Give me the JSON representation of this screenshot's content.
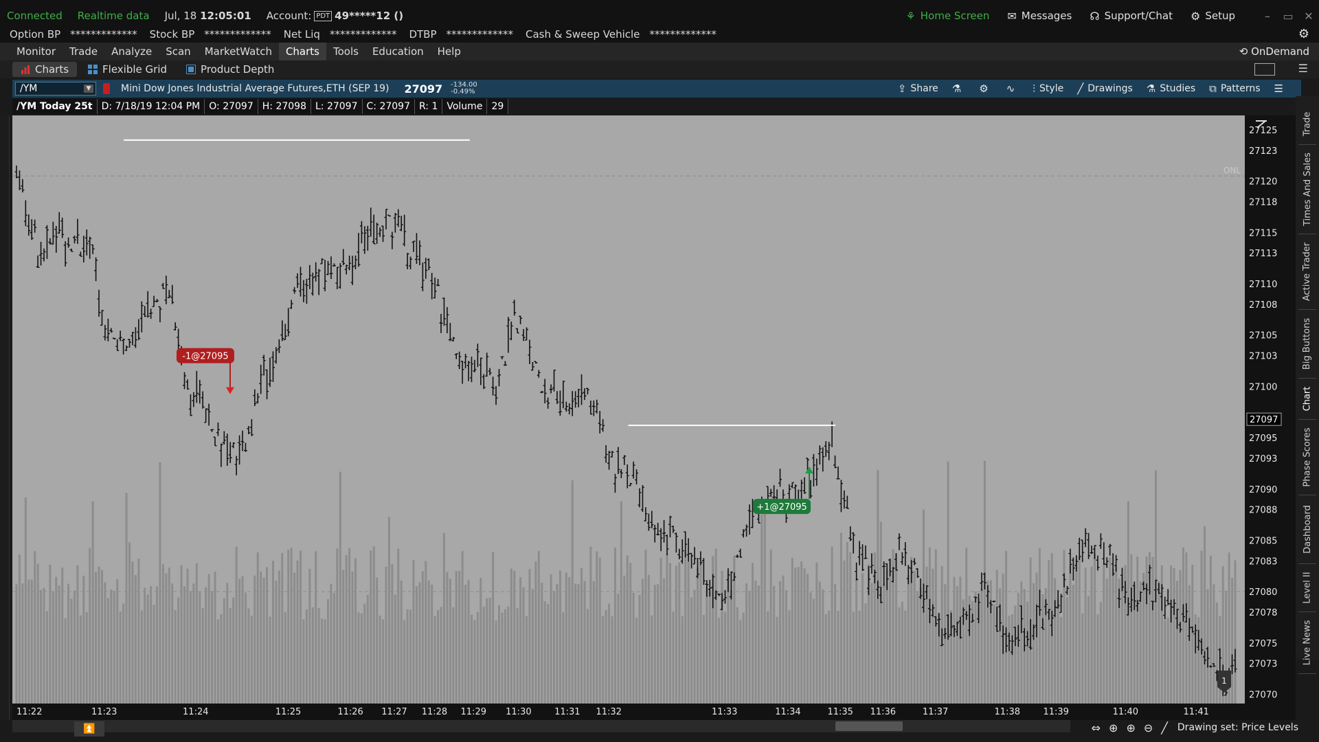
{
  "status_bar": {
    "connected": "Connected",
    "realtime": "Realtime data",
    "date": "Jul, 18",
    "time": "12:05:01",
    "account_label": "Account:",
    "pdt": "PDT",
    "account_id": "49*****12 ()",
    "home_screen": "Home Screen",
    "messages": "Messages",
    "support": "Support/Chat",
    "setup": "Setup",
    "accent_green": "#3fae49"
  },
  "account_row": [
    {
      "label": "Option BP",
      "value": "*************"
    },
    {
      "label": "Stock BP",
      "value": "*************"
    },
    {
      "label": "Net Liq",
      "value": "*************"
    },
    {
      "label": "DTBP",
      "value": "*************"
    },
    {
      "label": "Cash & Sweep Vehicle",
      "value": "*************"
    }
  ],
  "menu": {
    "items": [
      "Monitor",
      "Trade",
      "Analyze",
      "Scan",
      "MarketWatch",
      "Charts",
      "Tools",
      "Education",
      "Help"
    ],
    "active": "Charts",
    "ondemand": "OnDemand"
  },
  "subtabs": {
    "charts": "Charts",
    "flexible_grid": "Flexible Grid",
    "product_depth": "Product Depth"
  },
  "chart_header": {
    "symbol": "/YM",
    "instrument": "Mini Dow Jones Industrial Average Futures,ETH (SEP 19)",
    "last": "27097",
    "change": "-134.00",
    "change_pct": "-0.49%",
    "tools": {
      "share": "Share",
      "style": "Style",
      "drawings": "Drawings",
      "studies": "Studies",
      "patterns": "Patterns"
    }
  },
  "chart_info": {
    "title": "/YM Today 25t",
    "date": "D: 7/18/19 12:04 PM",
    "open": "O: 27097",
    "high": "H: 27098",
    "low": "L: 27097",
    "close": "C: 27097",
    "range": "R: 1",
    "volume_label": "Volume",
    "volume_value": "29"
  },
  "side_tabs": [
    "Trade",
    "Times And Sales",
    "Active Trader",
    "Big Buttons",
    "Chart",
    "Phase Scores",
    "Dashboard",
    "Level II",
    "Live News"
  ],
  "side_active": "Chart",
  "bottom": {
    "drawing_set": "Drawing set: Price Levels",
    "collapse_icon": "collapse-up-icon"
  },
  "chart_data": {
    "type": "bar",
    "y_ticks": [
      27125,
      27123,
      27120,
      27118,
      27115,
      27113,
      27110,
      27108,
      27105,
      27103,
      27100,
      27097,
      27095,
      27093,
      27090,
      27088,
      27085,
      27083,
      27080,
      27078,
      27075,
      27073,
      27070
    ],
    "ylim": [
      27069.5,
      27126
    ],
    "last_price_label": "27097",
    "x_ticks": [
      "11:22",
      "11:23",
      "11:24",
      "11:25",
      "11:26",
      "11:27",
      "11:28",
      "11:29",
      "11:30",
      "11:31",
      "11:32",
      "11:33",
      "11:34",
      "11:35",
      "11:36",
      "11:37",
      "11:38",
      "11:39",
      "11:40",
      "11:41"
    ],
    "x_tick_pos": [
      0.0,
      0.072,
      0.147,
      0.223,
      0.274,
      0.31,
      0.343,
      0.375,
      0.412,
      0.452,
      0.486,
      0.581,
      0.633,
      0.676,
      0.711,
      0.754,
      0.813,
      0.853,
      0.91,
      0.968
    ],
    "reference_lines": [
      {
        "label": "ONL",
        "price": 27120.5
      },
      {
        "label": "",
        "price": 27080.0
      }
    ],
    "horizontal_levels": [
      {
        "price": 27124,
        "from": 0.088,
        "to": 0.372
      },
      {
        "price": 27096.2,
        "from": 0.502,
        "to": 0.672
      }
    ],
    "orders": [
      {
        "label": "-1@27095",
        "price": 27103,
        "x": 0.155,
        "color": "#b01e1e",
        "direction": "sell"
      },
      {
        "label": "+1@27095",
        "price": 27088.3,
        "x": 0.628,
        "color": "#1e7a3a",
        "direction": "buy"
      }
    ],
    "close_path": [
      [
        0.0,
        27122
      ],
      [
        0.02,
        27112
      ],
      [
        0.03,
        27115
      ],
      [
        0.045,
        27114
      ],
      [
        0.06,
        27114
      ],
      [
        0.072,
        27106
      ],
      [
        0.09,
        27104
      ],
      [
        0.11,
        27107
      ],
      [
        0.125,
        27110
      ],
      [
        0.14,
        27100
      ],
      [
        0.155,
        27098
      ],
      [
        0.17,
        27094
      ],
      [
        0.185,
        27093
      ],
      [
        0.2,
        27100
      ],
      [
        0.215,
        27104
      ],
      [
        0.23,
        27109
      ],
      [
        0.25,
        27111
      ],
      [
        0.274,
        27112
      ],
      [
        0.29,
        27115
      ],
      [
        0.31,
        27116
      ],
      [
        0.325,
        27113
      ],
      [
        0.343,
        27110
      ],
      [
        0.36,
        27103
      ],
      [
        0.375,
        27102
      ],
      [
        0.395,
        27101
      ],
      [
        0.412,
        27107
      ],
      [
        0.43,
        27100
      ],
      [
        0.452,
        27098
      ],
      [
        0.47,
        27100
      ],
      [
        0.486,
        27093
      ],
      [
        0.505,
        27091
      ],
      [
        0.52,
        27086
      ],
      [
        0.54,
        27085
      ],
      [
        0.56,
        27082
      ],
      [
        0.581,
        27079
      ],
      [
        0.6,
        27086
      ],
      [
        0.615,
        27090
      ],
      [
        0.633,
        27089
      ],
      [
        0.655,
        27092
      ],
      [
        0.667,
        27095
      ],
      [
        0.676,
        27091
      ],
      [
        0.69,
        27083
      ],
      [
        0.711,
        27081
      ],
      [
        0.73,
        27084
      ],
      [
        0.754,
        27077
      ],
      [
        0.775,
        27076
      ],
      [
        0.795,
        27081
      ],
      [
        0.813,
        27075
      ],
      [
        0.83,
        27077
      ],
      [
        0.853,
        27078
      ],
      [
        0.875,
        27085
      ],
      [
        0.895,
        27084
      ],
      [
        0.91,
        27079
      ],
      [
        0.93,
        27080
      ],
      [
        0.95,
        27078
      ],
      [
        0.968,
        27076
      ],
      [
        0.985,
        27072
      ],
      [
        1.0,
        27073
      ]
    ]
  }
}
